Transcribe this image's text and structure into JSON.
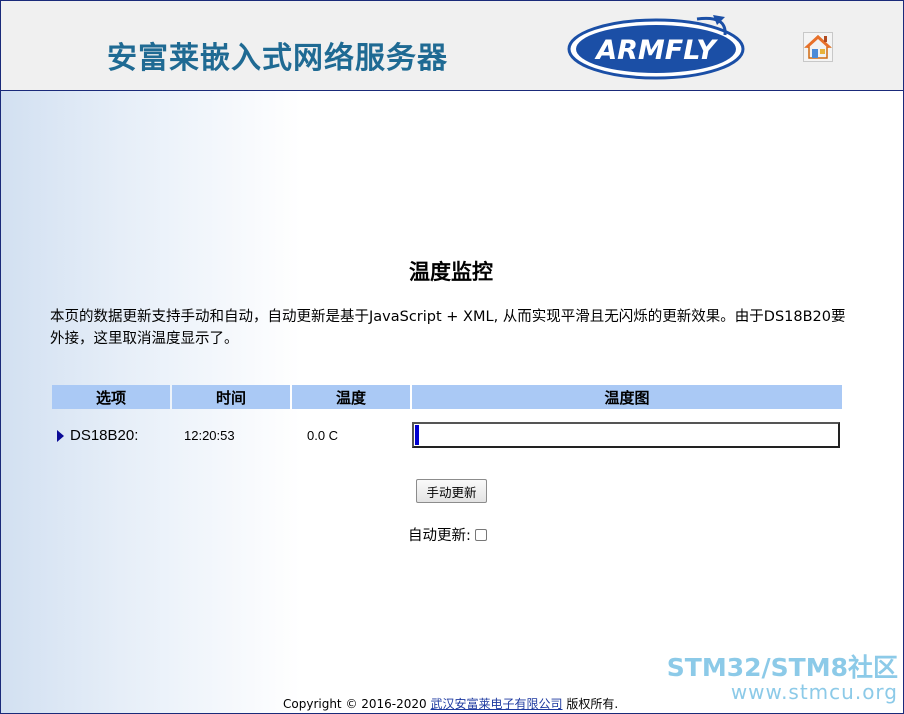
{
  "header": {
    "title": "安富莱嵌入式网络服务器",
    "logo_text": "ARMFLY",
    "home_icon": "home-icon"
  },
  "main": {
    "heading": "温度监控",
    "description": "本页的数据更新支持手动和自动，自动更新是基于JavaScript + XML, 从而实现平滑且无闪烁的更新效果。由于DS18B20要外接，这里取消温度显示了。",
    "table": {
      "columns": [
        "选项",
        "时间",
        "温度",
        "温度图"
      ],
      "rows": [
        {
          "option": "DS18B20:",
          "time": "12:20:53",
          "temperature": "0.0 C",
          "bar_fraction": 0.01
        }
      ]
    },
    "manual_update_label": "手动更新",
    "auto_update_label": "自动更新:",
    "auto_update_checked": false
  },
  "footer": {
    "prefix": "Copyright © 2016-2020 ",
    "company_link": "武汉安富莱电子有限公司",
    "suffix": " 版权所有."
  },
  "watermark": {
    "line1": "STM32/STM8社区",
    "line2": "www.stmcu.org"
  },
  "colors": {
    "title": "#1f6a93",
    "table_header": "#aac9f5",
    "bar_fill": "#0000d0",
    "logo": "#1b4fa6"
  }
}
